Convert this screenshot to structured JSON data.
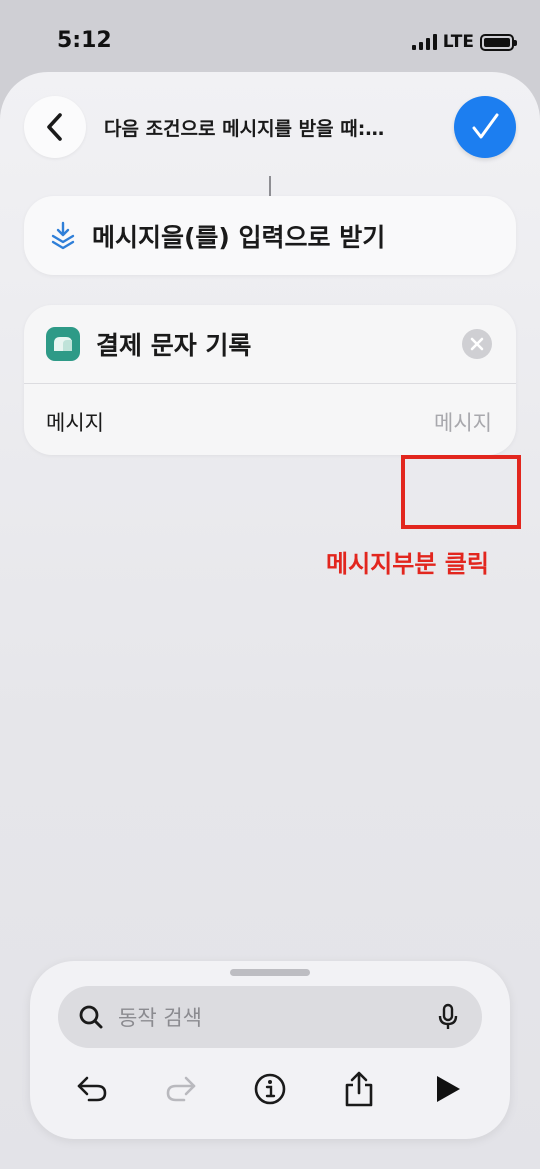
{
  "status_bar": {
    "time": "5:12",
    "network": "LTE"
  },
  "header": {
    "title": "다음 조건으로 메시지를 받을 때:…",
    "back_icon": "chevron-left-icon",
    "done_icon": "checkmark-icon"
  },
  "input_block": {
    "label": "메시지을(를) 입력으로 받기",
    "icon": "layers-icon"
  },
  "action_block": {
    "title": "결제 문자 기록",
    "icon": "app-icon",
    "param_label": "메시지",
    "param_placeholder": "메시지"
  },
  "annotation": {
    "text": "메시지부분 클릭",
    "color": "#e2261e"
  },
  "bottom_panel": {
    "search_placeholder": "동작 검색",
    "toolbar": [
      "undo-icon",
      "redo-icon",
      "info-icon",
      "share-icon",
      "play-icon"
    ]
  },
  "colors": {
    "accent": "#1c7ef0",
    "app_icon": "#2e9a87",
    "annotation": "#e2261e"
  }
}
